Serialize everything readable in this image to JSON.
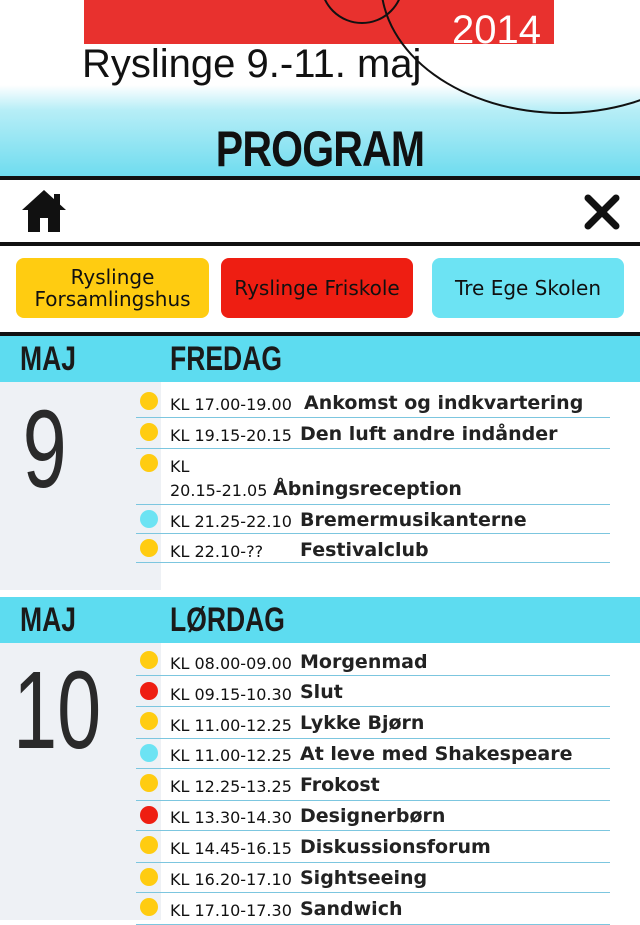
{
  "header": {
    "year": "2014",
    "subtitle": "Ryslinge 9.-11. maj",
    "page_title": "PROGRAM"
  },
  "toolbar": {
    "home_icon": "home-icon",
    "close_icon": "close-icon"
  },
  "filters": [
    {
      "label": "Ryslinge Forsamlingshus",
      "color": "#ffcc11"
    },
    {
      "label": "Ryslinge Friskole",
      "color": "#ee1e12"
    },
    {
      "label": "Tre Ege Skolen",
      "color": "#6ce3f3"
    }
  ],
  "days": [
    {
      "month": "MAJ",
      "weekday": "FREDAG",
      "day": "9",
      "events": [
        {
          "time": "KL 17.00-19.00",
          "title": "Ankomst og indkvartering",
          "venue_color": "#ffcc11"
        },
        {
          "time": "KL 19.15-20.15",
          "title": "Den luft andre indånder",
          "venue_color": "#ffcc11"
        },
        {
          "time": "KL",
          "time2": "20.15-21.05",
          "title": "Åbningsreception",
          "venue_color": "#ffcc11"
        },
        {
          "time": "KL 21.25-22.10",
          "title": "Bremermusikanterne",
          "venue_color": "#6ce3f3"
        },
        {
          "time": "KL 22.10-??",
          "title": "Festivalclub",
          "venue_color": "#ffcc11"
        }
      ]
    },
    {
      "month": "MAJ",
      "weekday": "LØRDAG",
      "day": "10",
      "events": [
        {
          "time": "KL 08.00-09.00",
          "title": "Morgenmad",
          "venue_color": "#ffcc11"
        },
        {
          "time": "KL 09.15-10.30",
          "title": "Slut",
          "venue_color": "#ee1e12"
        },
        {
          "time": "KL 11.00-12.25",
          "title": "Lykke Bjørn",
          "venue_color": "#ffcc11"
        },
        {
          "time": "KL 11.00-12.25",
          "title": "At leve med Shakespeare",
          "venue_color": "#6ce3f3"
        },
        {
          "time": "KL 12.25-13.25",
          "title": "Frokost",
          "venue_color": "#ffcc11"
        },
        {
          "time": "KL 13.30-14.30",
          "title": "Designerbørn",
          "venue_color": "#ee1e12"
        },
        {
          "time": "KL 14.45-16.15",
          "title": "Diskussionsforum",
          "venue_color": "#ffcc11"
        },
        {
          "time": "KL 16.20-17.10",
          "title": "Sightseeing",
          "venue_color": "#ffcc11"
        },
        {
          "time": "KL 17.10-17.30",
          "title": "Sandwich",
          "venue_color": "#ffcc11"
        }
      ]
    }
  ]
}
